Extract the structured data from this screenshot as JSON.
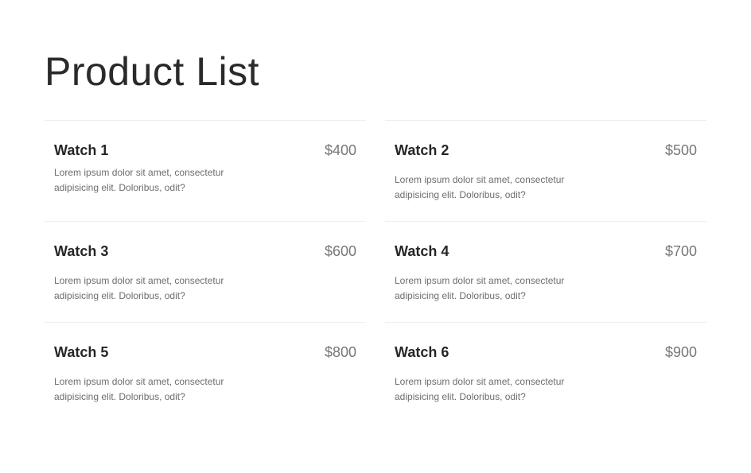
{
  "page": {
    "title": "Product List"
  },
  "products": [
    {
      "name": "Watch 1",
      "price": "$400",
      "description": "Lorem ipsum dolor sit amet, consectetur adipisicing elit. Doloribus, odit?"
    },
    {
      "name": "Watch 2",
      "price": "$500",
      "description": "Lorem ipsum dolor sit amet, consectetur adipisicing elit. Doloribus, odit?"
    },
    {
      "name": "Watch 3",
      "price": "$600",
      "description": "Lorem ipsum dolor sit amet, consectetur adipisicing elit. Doloribus, odit?"
    },
    {
      "name": "Watch 4",
      "price": "$700",
      "description": "Lorem ipsum dolor sit amet, consectetur adipisicing elit. Doloribus, odit?"
    },
    {
      "name": "Watch 5",
      "price": "$800",
      "description": "Lorem ipsum dolor sit amet, consectetur adipisicing elit. Doloribus, odit?"
    },
    {
      "name": "Watch 6",
      "price": "$900",
      "description": "Lorem ipsum dolor sit amet, consectetur adipisicing elit. Doloribus, odit?"
    }
  ],
  "colors": {
    "background": "#ffffff",
    "title": "#2a2a2a",
    "name": "#262626",
    "price": "#777777",
    "description": "#6d6d6d",
    "divider": "#efefef"
  }
}
